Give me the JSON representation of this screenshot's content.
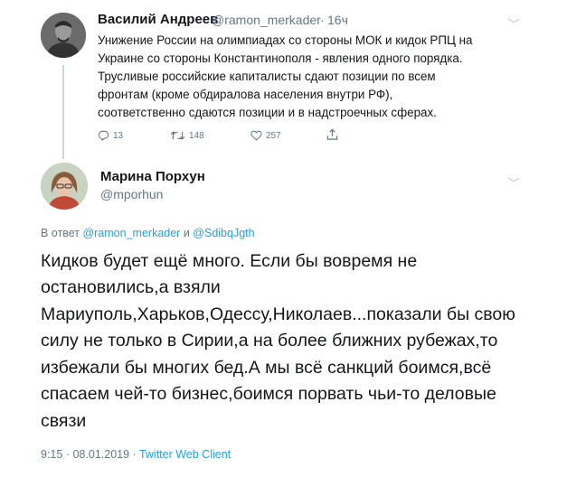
{
  "parent": {
    "name": "Василий Андреев",
    "handle": "@ramon_merkader",
    "separator": "·",
    "time": "16ч",
    "lines": [
      "Унижение России на олимпиадах со стороны МОК и кидок РПЦ на",
      "Украине со стороны Константинополя - явления одного порядка.",
      "Трусливые российские капиталисты сдают позиции по всем",
      "фронтам (кроме обдиралова населения внутри РФ),",
      "соответственно сдаются позиции и в надстроечных сферах."
    ],
    "actions": {
      "replies": "13",
      "retweets": "148",
      "likes": "257"
    }
  },
  "reply": {
    "name": "Марина Порхун",
    "handle": "@mporhun",
    "replying": {
      "prefix": "В ответ",
      "user1": "@ramon_merkader",
      "conj": "и",
      "user2": "@SdibqJgth"
    },
    "lines": [
      "Кидков будет ещё много. Если бы вовремя не",
      "остановились,а взяли",
      "Мариуполь,Харьков,Одессу,Николаев...показали бы свою",
      "силу не только в Сирии,а на более ближних рубежах,то",
      "избежали бы многих бед.А мы всё санкций боимся,всё",
      "спасаем чей-то бизнес,боимся порвать чьи-то  деловые",
      "связи"
    ],
    "meta": {
      "time": "9:15",
      "sep1": "·",
      "date": "08.01.2019",
      "sep2": "·",
      "client": "Twitter Web Client"
    }
  },
  "icons": {
    "parent_avatar": "person-photo",
    "reply_avatar": "person-photo",
    "parent_menu": "chevron-down-icon",
    "reply_menu": "chevron-down-icon",
    "reply": "reply-icon",
    "retweet": "retweet-icon",
    "like": "heart-icon",
    "share": "share-icon"
  },
  "colors": {
    "link": "#1da1f2",
    "muted": "#657786",
    "text": "#14171a",
    "thread_line": "#ccd6dd"
  }
}
